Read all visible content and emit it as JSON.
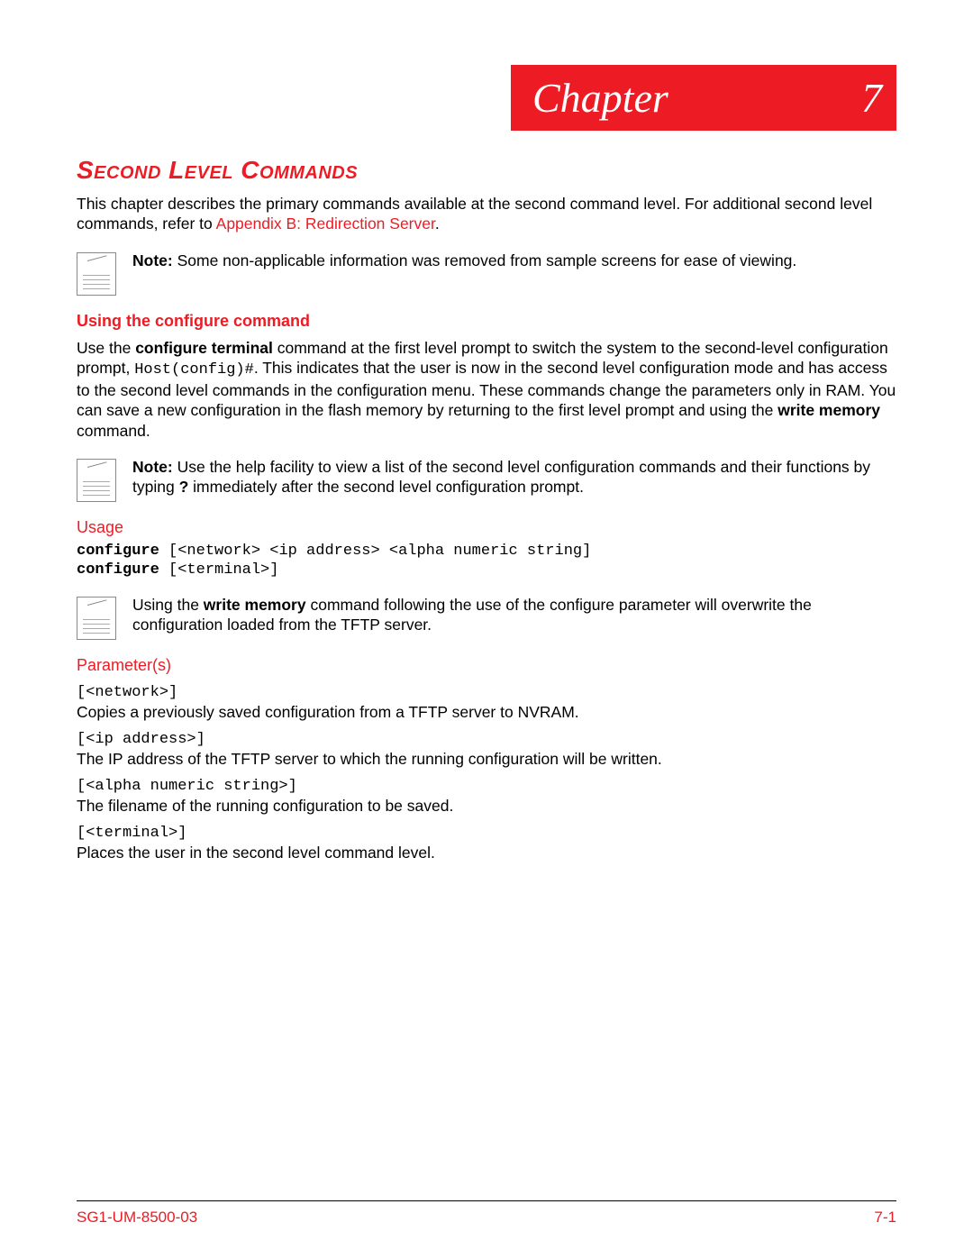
{
  "chapter": {
    "label": "Chapter",
    "number": "7"
  },
  "title": "Second Level Commands",
  "intro": {
    "text_pre": "This chapter describes the primary commands available at the second command level. For additional second level commands, refer to ",
    "link": "Appendix B: Redirection Server",
    "text_post": "."
  },
  "note1": {
    "label": "Note:",
    "text": " Some non-applicable information was removed from sample screens for ease of viewing."
  },
  "configure_heading": "Using the configure command",
  "configure_para": {
    "a": "Use the ",
    "b": "configure terminal",
    "c": " command at the first level prompt to switch the system to the second-level configuration prompt, ",
    "d": "Host(config)#",
    "e": ". This indicates that the user is now in the second level configuration mode and has access to the second level commands in the configuration menu. These commands change the parameters only in RAM. You can save a new configuration in the flash memory by returning to the first level prompt and using the ",
    "f": "write memory",
    "g": " command."
  },
  "note2": {
    "label": "Note:",
    "a": " Use the help facility to view a list of the second level configuration commands and their functions by typing ",
    "b": "?",
    "c": " immediately after the second level configuration prompt."
  },
  "usage_heading": "Usage",
  "usage1": {
    "cmd": "configure",
    "args": " [<network> <ip address> <alpha numeric string]"
  },
  "usage2": {
    "cmd": "configure",
    "args": " [<terminal>]"
  },
  "note3": {
    "a": "Using the ",
    "b": "write memory",
    "c": " command following the use of the configure parameter will overwrite the configuration loaded from the TFTP server."
  },
  "params_heading": "Parameter(s)",
  "params": {
    "p1_code": "[<network>]",
    "p1_desc": "Copies a previously saved configuration from a TFTP server to NVRAM.",
    "p2_code": "[<ip address>]",
    "p2_desc": "The IP address of the TFTP server to which the running configuration will be written.",
    "p3_code": "[<alpha numeric string>]",
    "p3_desc": "The filename of the running configuration to be saved.",
    "p4_code": "[<terminal>]",
    "p4_desc": "Places the user in the second level command level."
  },
  "footer": {
    "left": "SG1-UM-8500-03",
    "right": "7-1"
  }
}
